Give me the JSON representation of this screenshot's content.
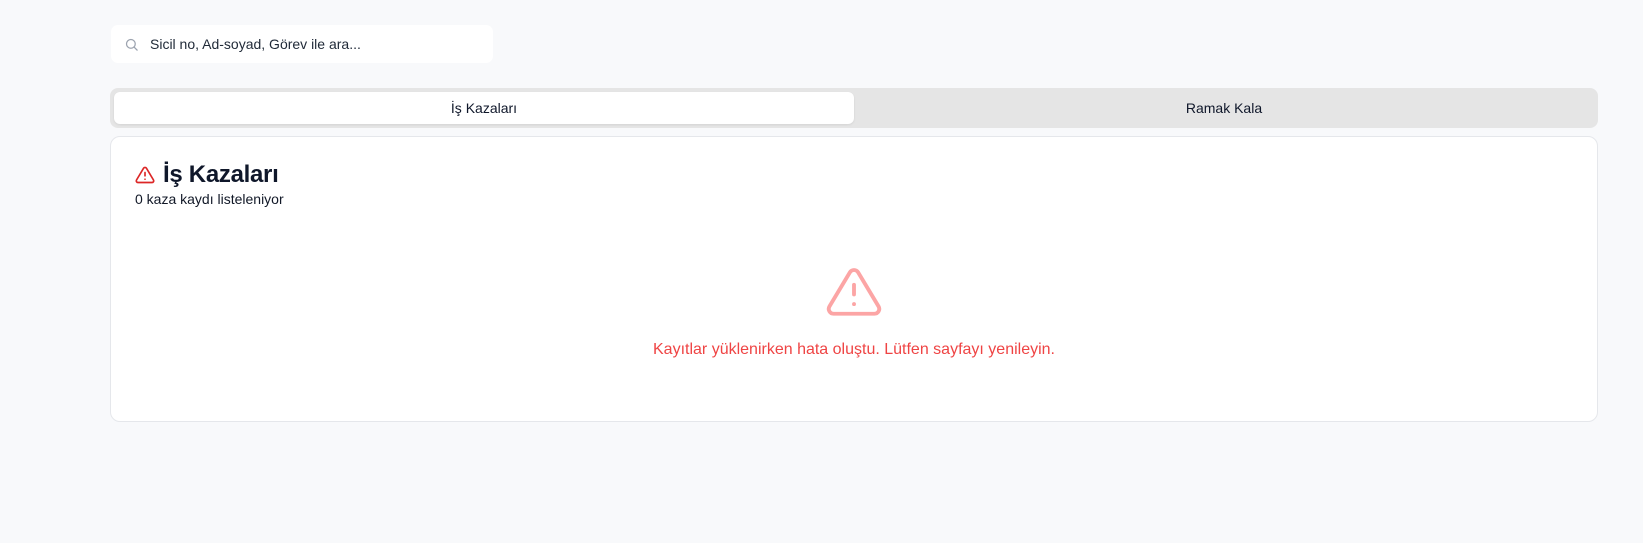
{
  "search": {
    "placeholder": "Sicil no, Ad-soyad, Görev ile ara...",
    "value": ""
  },
  "tabs": [
    {
      "label": "İş Kazaları",
      "active": true
    },
    {
      "label": "Ramak Kala",
      "active": false
    }
  ],
  "card": {
    "title": "İş Kazaları",
    "subtitle": "0 kaza kaydı listeleniyor",
    "error_message": "Kayıtlar yüklenirken hata oluştu. Lütfen sayfayı yenileyin."
  },
  "icons": {
    "search": "search-icon",
    "title": "alert-triangle-icon",
    "error": "alert-triangle-icon"
  },
  "colors": {
    "background": "#f8f9fb",
    "error_text": "#ef4444",
    "error_icon": "#fca5a5",
    "title_icon": "#dc2626",
    "tab_bar": "#e5e5e5"
  }
}
